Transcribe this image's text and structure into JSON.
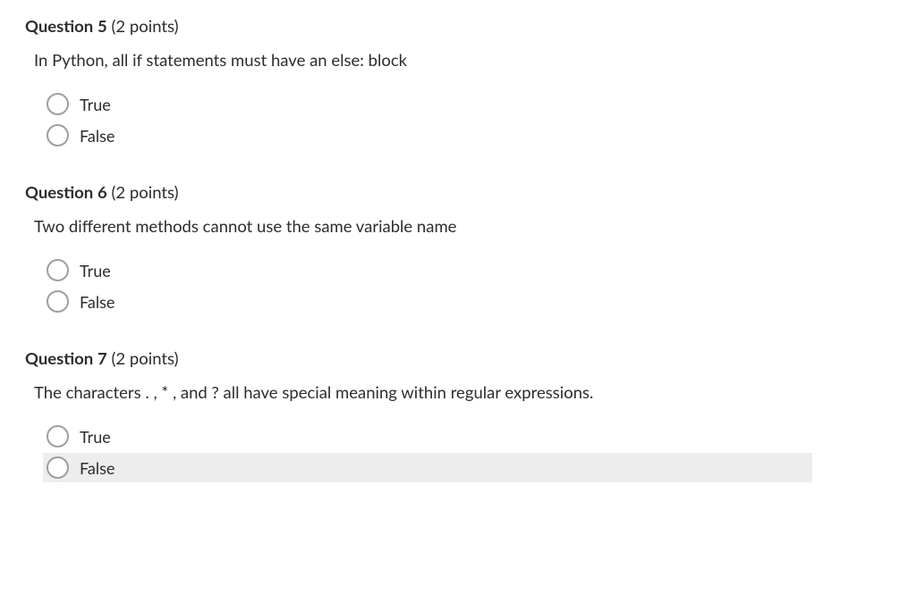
{
  "questions": [
    {
      "label": "Question",
      "number": "5",
      "points": "(2 points)",
      "prompt": "In Python, all if statements must have an else:  block",
      "options": [
        {
          "label": "True",
          "highlighted": false
        },
        {
          "label": "False",
          "highlighted": false
        }
      ]
    },
    {
      "label": "Question",
      "number": "6",
      "points": "(2 points)",
      "prompt": "Two different methods cannot use the same variable name",
      "options": [
        {
          "label": "True",
          "highlighted": false
        },
        {
          "label": "False",
          "highlighted": false
        }
      ]
    },
    {
      "label": "Question",
      "number": "7",
      "points": "(2 points)",
      "prompt": "The characters . , * , and ? all have special meaning within regular expressions.",
      "options": [
        {
          "label": "True",
          "highlighted": false
        },
        {
          "label": "False",
          "highlighted": true
        }
      ]
    }
  ]
}
